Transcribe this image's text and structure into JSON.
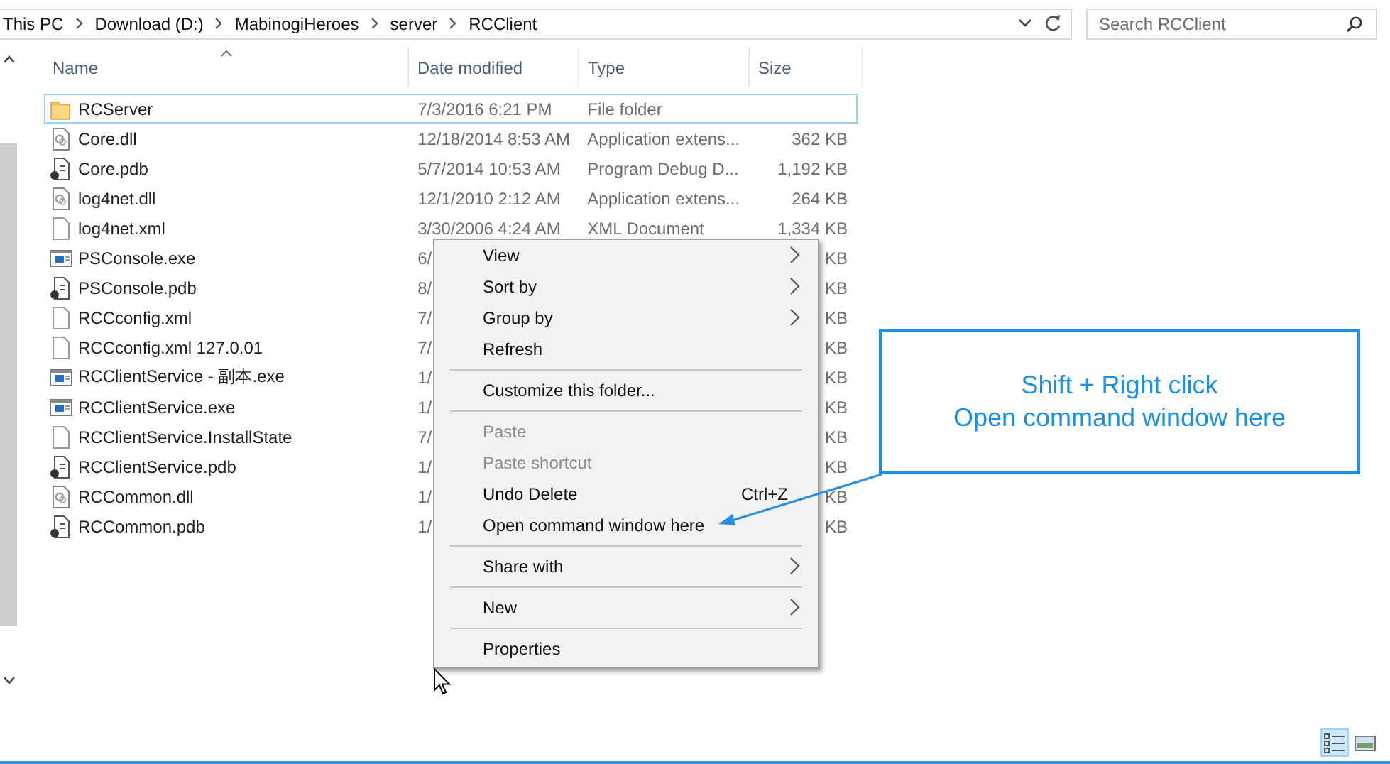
{
  "address_bar": {
    "crumbs": [
      "This PC",
      "Download (D:)",
      "MabinogiHeroes",
      "server",
      "RCClient"
    ]
  },
  "search": {
    "placeholder": "Search RCClient"
  },
  "table": {
    "columns": [
      {
        "label": "Name",
        "sorted": true
      },
      {
        "label": "Date modified",
        "sorted": false
      },
      {
        "label": "Type",
        "sorted": false
      },
      {
        "label": "Size",
        "sorted": false
      }
    ],
    "rows": [
      {
        "kind": "folder",
        "name": "RCServer",
        "date": "7/3/2016 6:21 PM",
        "file_type": "File folder",
        "focused": true
      },
      {
        "kind": "dll",
        "name": "Core.dll",
        "date": "12/18/2014 8:53 AM",
        "file_type": "Application extens...",
        "size": "362 KB",
        "focused": false
      },
      {
        "kind": "pdb",
        "name": "Core.pdb",
        "date": "5/7/2014 10:53 AM",
        "file_type": "Program Debug D...",
        "size": "1,192 KB",
        "focused": false
      },
      {
        "kind": "dll",
        "name": "log4net.dll",
        "date": "12/1/2010 2:12 AM",
        "file_type": "Application extens...",
        "size": "264 KB",
        "focused": false
      },
      {
        "kind": "doc",
        "name": "log4net.xml",
        "date": "3/30/2006 4:24 AM",
        "file_type": "XML Document",
        "size": "1,334 KB",
        "focused": false
      },
      {
        "kind": "exe",
        "name": "PSConsole.exe",
        "date": "6/",
        "size": "KB",
        "focused": false
      },
      {
        "kind": "pdb",
        "name": "PSConsole.pdb",
        "date": "8/",
        "size": "KB",
        "focused": false
      },
      {
        "kind": "doc",
        "name": "RCCconfig.xml",
        "date": "7/",
        "size": "KB",
        "focused": false
      },
      {
        "kind": "doc",
        "name": "RCCconfig.xml 127.0.01",
        "date": "7/",
        "size": "KB",
        "focused": false
      },
      {
        "kind": "exe",
        "name": "RCClientService - 副本.exe",
        "date": "1/",
        "size": "KB",
        "focused": false
      },
      {
        "kind": "exe",
        "name": "RCClientService.exe",
        "date": "1/",
        "size": "KB",
        "focused": false
      },
      {
        "kind": "doc",
        "name": "RCClientService.InstallState",
        "date": "7/",
        "size": "KB",
        "focused": false
      },
      {
        "kind": "pdb",
        "name": "RCClientService.pdb",
        "date": "1/",
        "size": "KB",
        "focused": false
      },
      {
        "kind": "dll",
        "name": "RCCommon.dll",
        "date": "1/",
        "size": "KB",
        "focused": false
      },
      {
        "kind": "pdb",
        "name": "RCCommon.pdb",
        "date": "1/",
        "size": "KB",
        "focused": false
      }
    ]
  },
  "context_menu": {
    "items": [
      {
        "kind": "item",
        "label": "View",
        "submenu": true,
        "disabled": false
      },
      {
        "kind": "item",
        "label": "Sort by",
        "submenu": true,
        "disabled": false
      },
      {
        "kind": "item",
        "label": "Group by",
        "submenu": true,
        "disabled": false
      },
      {
        "kind": "item",
        "label": "Refresh",
        "submenu": false,
        "disabled": false
      },
      {
        "kind": "separator"
      },
      {
        "kind": "item",
        "label": "Customize this folder...",
        "submenu": false,
        "disabled": false
      },
      {
        "kind": "separator"
      },
      {
        "kind": "item",
        "label": "Paste",
        "submenu": false,
        "disabled": true
      },
      {
        "kind": "item",
        "label": "Paste shortcut",
        "submenu": false,
        "disabled": true
      },
      {
        "kind": "item",
        "label": "Undo Delete",
        "shortcut": "Ctrl+Z",
        "submenu": false,
        "disabled": false
      },
      {
        "kind": "item",
        "label": "Open command window here",
        "submenu": false,
        "disabled": false
      },
      {
        "kind": "separator"
      },
      {
        "kind": "item",
        "label": "Share with",
        "submenu": true,
        "disabled": false
      },
      {
        "kind": "separator"
      },
      {
        "kind": "item",
        "label": "New",
        "submenu": true,
        "disabled": false
      },
      {
        "kind": "separator"
      },
      {
        "kind": "item",
        "label": "Properties",
        "submenu": false,
        "disabled": false
      }
    ]
  },
  "callout": {
    "lines": [
      "Shift + Right click",
      "Open command window here"
    ]
  },
  "view_buttons": [
    {
      "kind": "details",
      "selected": true
    },
    {
      "kind": "large_icons",
      "selected": false
    }
  ]
}
